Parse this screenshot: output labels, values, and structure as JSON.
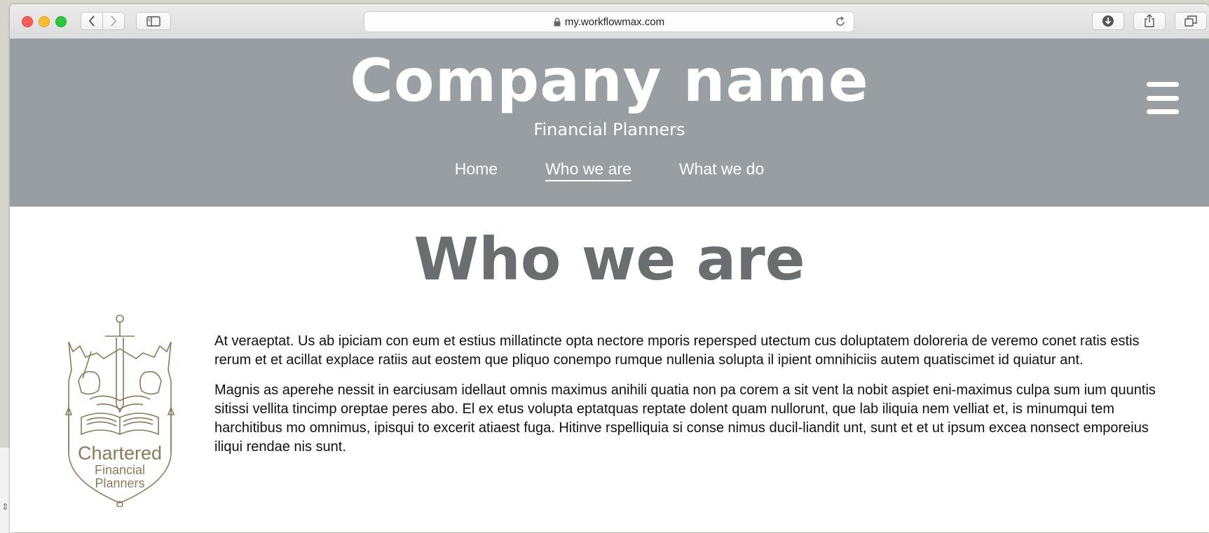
{
  "browser": {
    "url": "my.workflowmax.com"
  },
  "header": {
    "company_name": "Company name",
    "tagline": "Financial Planners",
    "nav": [
      {
        "label": "Home",
        "active": false
      },
      {
        "label": "Who we are",
        "active": true
      },
      {
        "label": "What we do",
        "active": false
      }
    ]
  },
  "main": {
    "title": "Who we are",
    "paragraphs": [
      "At veraeptat. Us ab ipiciam con eum et estius millatincte opta nectore mporis repersped utectum cus doluptatem doloreria de veremo conet ratis estis rerum et et acillat explace ratiis aut eostem que pliquo conempo rumque nullenia solupta il ipient omnihiciis autem quatiscimet id quiatur ant.",
      "Magnis as aperehe nessit in earciusam idellaut omnis maximus anihili quatia non pa corem a sit vent la nobit aspiet eni-maximus culpa sum ium quuntis sitissi vellita tincimp oreptae peres abo. El ex etus volupta eptatquas reptate dolent quam nullorunt, que lab iliquia nem velliat et, is minumqui tem harchitibus mo omnimus, ipisqui to excerit atiaest fuga. Hitinve rspelliquia si conse nimus ducil-liandit unt, sunt et et ut ipsum excea nonsect emporeius iliqui rendae nis sunt."
    ],
    "crest": {
      "line1": "Chartered",
      "line2": "Financial",
      "line3": "Planners"
    }
  },
  "colors": {
    "header_bg": "#999ea2",
    "title_gray": "#6a6e70",
    "crest_gold": "#8a7a5a"
  }
}
